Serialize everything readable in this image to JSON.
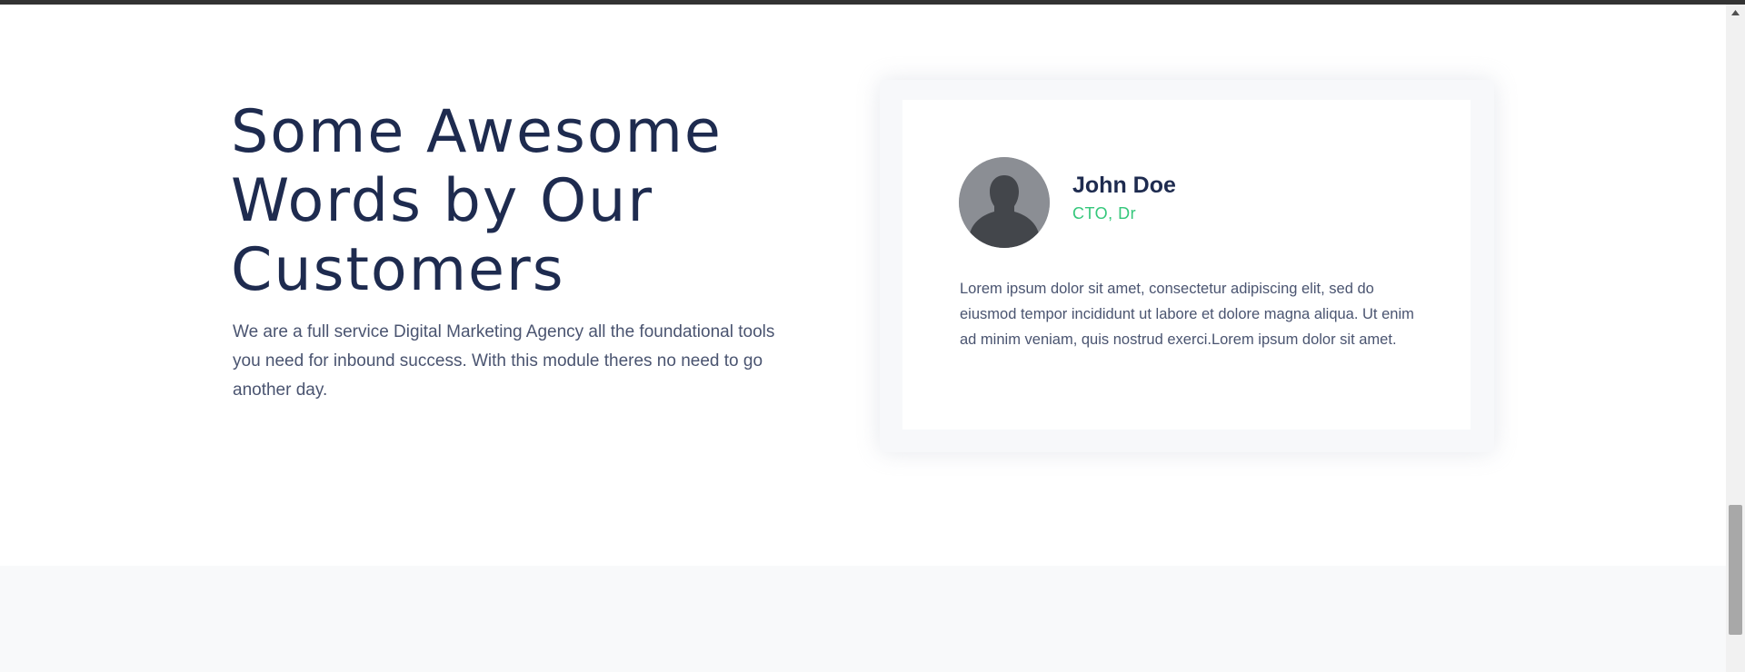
{
  "testimonials": {
    "heading": "Some Awesome Words by Our Customers",
    "lead": "We are a full service Digital Marketing Agency all the foundational tools you need for inbound success. With this module theres no need to go another day.",
    "card": {
      "name": "John Doe",
      "role": "CTO, Dr",
      "quote": "Lorem ipsum dolor sit amet, consectetur adipiscing elit, sed do eiusmod tempor incididunt ut labore et dolore magna aliqua. Ut enim ad minim veniam, quis nostrud exerci.Lorem ipsum dolor sit amet.",
      "avatar_icon": "person-silhouette-icon"
    }
  },
  "colors": {
    "heading": "#1e2b4f",
    "body_text": "#4a5470",
    "accent_green": "#34c77b",
    "section_alt_bg": "#f8f9fa"
  },
  "scrollbar": {
    "up_icon": "scroll-up-arrow-icon",
    "position_fraction": 0.78
  }
}
